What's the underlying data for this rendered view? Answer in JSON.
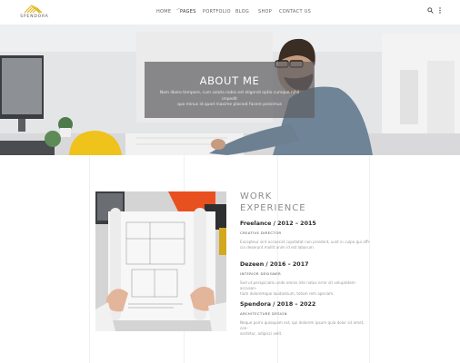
{
  "brand": {
    "name": "SPENDORA",
    "accent": "#e6b92e"
  },
  "nav": {
    "items": [
      {
        "label": "HOME"
      },
      {
        "label": "PAGES"
      },
      {
        "label": "PORTFOLIO"
      },
      {
        "label": "BLOG"
      },
      {
        "label": "SHOP"
      },
      {
        "label": "CONTACT US"
      }
    ],
    "icons": [
      "search-icon",
      "more-vertical-icon"
    ]
  },
  "hero": {
    "title": "ABOUT ME",
    "text_line1": "Nam libero tempore, cum soluta nobis est eligendi optio cumque nihil impedit",
    "text_line2": "quo minus id quod maxime placeat facere possimus"
  },
  "experience": {
    "title_line1": "WORK",
    "title_line2": "EXPERIENCE",
    "jobs": [
      {
        "title": "Freelance / 2012 – 2015",
        "role": "CREATIVE DIRECTOR",
        "desc_line1": "Excepteur sint occaecat cupidatat non proident, sunt in culpa qui offi-",
        "desc_line2": "cia deserunt mollit anim id est laborum."
      },
      {
        "title": "Dezeen / 2016 – 2017",
        "role": "INTERIOR DESIGNER",
        "desc_line1": "Sed ut perspiciatis unde omnis iste natus error sit voluptatem accusan-",
        "desc_line2": "tium doloremque laudantium, totam rem aperiam."
      },
      {
        "title": "Spendora / 2018 – 2022",
        "role": "ARCHITECTURE DESIGN",
        "desc_line1": "Neque porro quisquam est, qui dolorem ipsum quia dolor sit amet, con-",
        "desc_line2": "sectetur, adipisci velit."
      }
    ]
  }
}
